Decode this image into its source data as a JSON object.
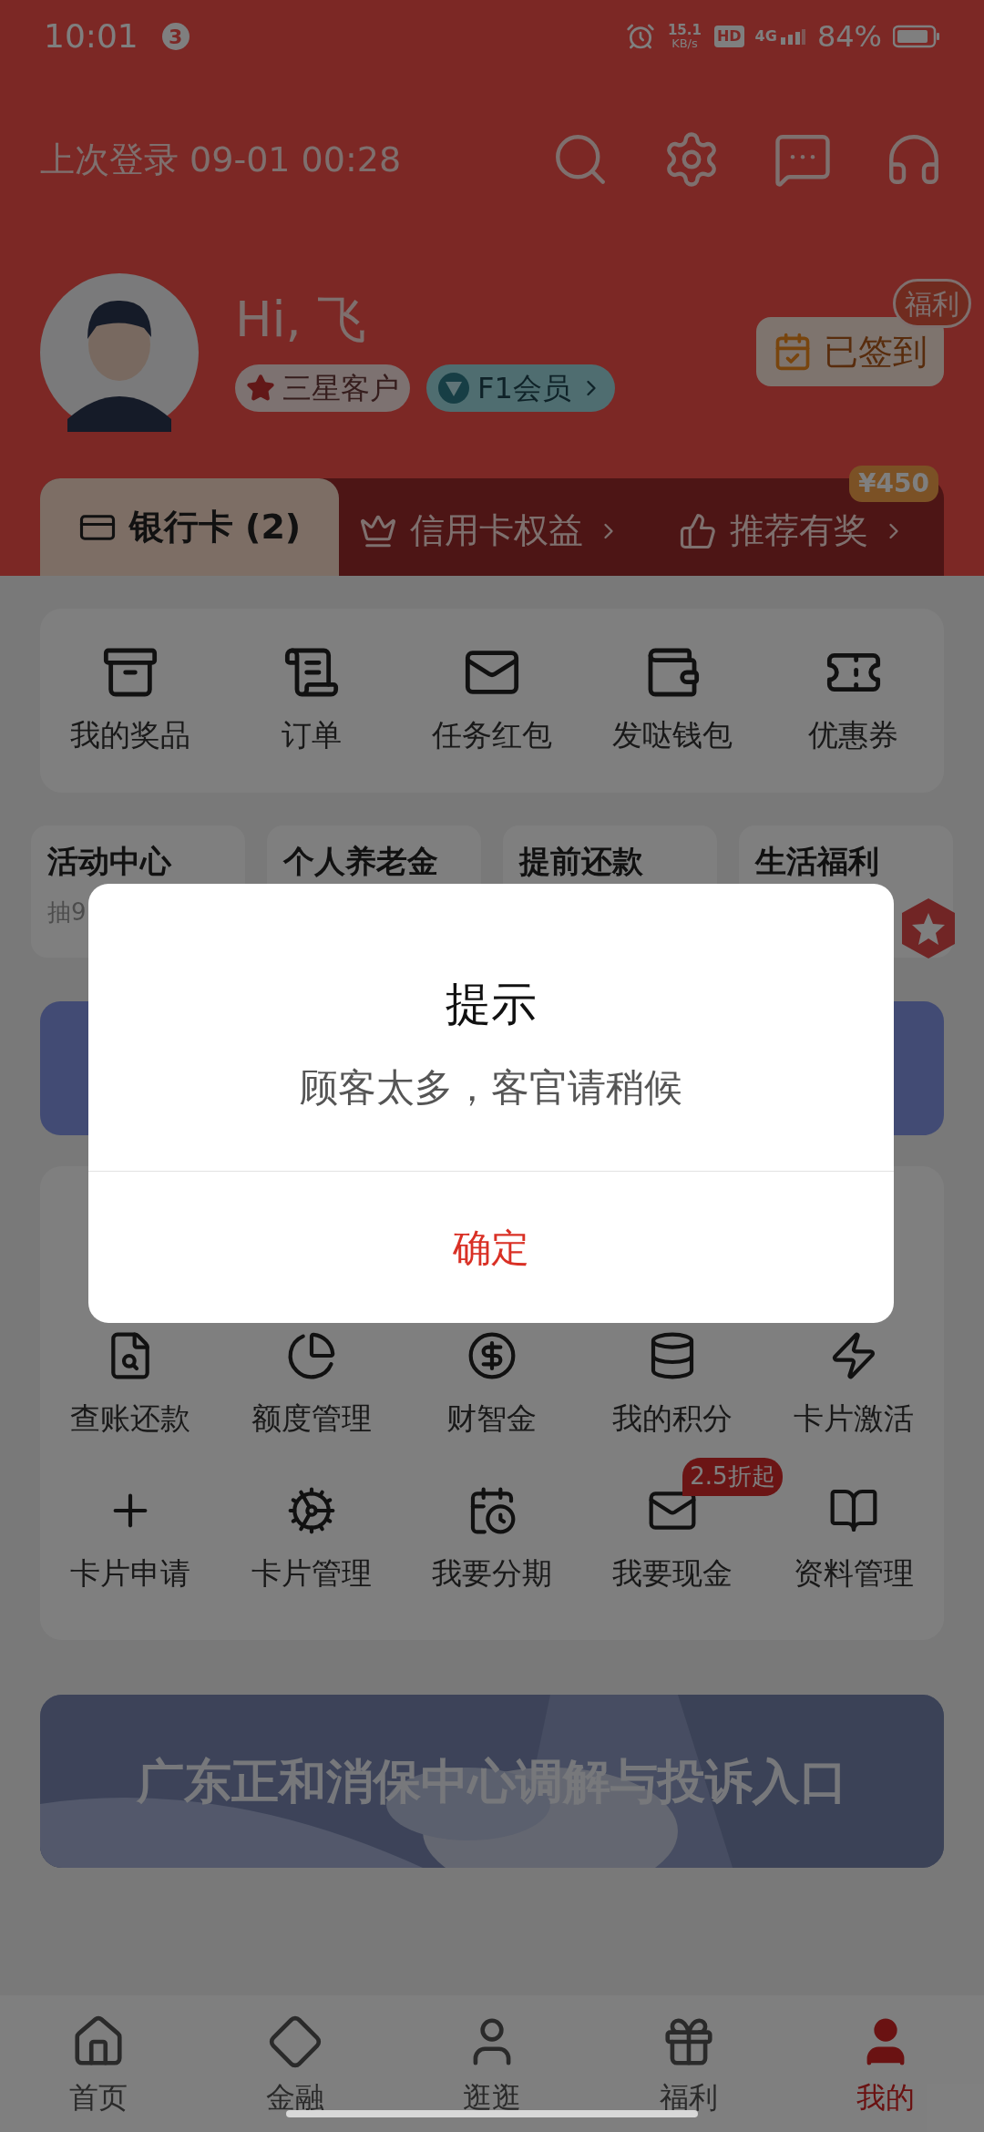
{
  "status_bar": {
    "time": "10:01",
    "notification_count": "3",
    "net_speed": "15.1",
    "net_unit": "KB/s",
    "hd": "HD",
    "network": "4G",
    "battery": "84%"
  },
  "header": {
    "last_login": "上次登录 09-01 00:28",
    "greeting": "Hi, 飞",
    "badges": [
      {
        "label": "三星客户",
        "kind": "star"
      },
      {
        "label": "F1会员",
        "kind": "member"
      }
    ],
    "checkin": {
      "label": "已签到",
      "tag": "福利"
    }
  },
  "tabs": [
    {
      "label": "银行卡 (2)",
      "selected": true,
      "kind": "card"
    },
    {
      "label": "信用卡权益",
      "selected": false,
      "kind": "crown"
    },
    {
      "label": "推荐有奖",
      "selected": false,
      "kind": "thumb",
      "badge": "¥450"
    }
  ],
  "shortcuts": [
    {
      "label": "我的奖品",
      "kind": "box"
    },
    {
      "label": "订单",
      "kind": "scroll"
    },
    {
      "label": "任务红包",
      "kind": "envelope"
    },
    {
      "label": "发哒钱包",
      "kind": "wallet"
    },
    {
      "label": "优惠券",
      "kind": "ticket"
    }
  ],
  "activities": [
    {
      "title": "活动中心",
      "subtitle": "抽9"
    },
    {
      "title": "个人养老金"
    },
    {
      "title": "提前还款"
    },
    {
      "title": "生活福利"
    }
  ],
  "credit_services": [
    {
      "label": "查账还款",
      "kind": "bill"
    },
    {
      "label": "额度管理",
      "kind": "pie"
    },
    {
      "label": "财智金",
      "kind": "yen"
    },
    {
      "label": "我的积分",
      "kind": "coins"
    },
    {
      "label": "卡片激活",
      "kind": "activate"
    },
    {
      "label": "卡片申请",
      "kind": "apply"
    },
    {
      "label": "卡片管理",
      "kind": "manage"
    },
    {
      "label": "我要分期",
      "kind": "calendar"
    },
    {
      "label": "我要现金",
      "kind": "cash",
      "badge": "2.5折起"
    },
    {
      "label": "资料管理",
      "kind": "book"
    }
  ],
  "banner": {
    "text": "广东正和消保中心调解与投诉入口"
  },
  "bottom_nav": [
    {
      "label": "首页",
      "selected": false,
      "kind": "home"
    },
    {
      "label": "金融",
      "selected": false,
      "kind": "finance"
    },
    {
      "label": "逛逛",
      "selected": false,
      "kind": "browse"
    },
    {
      "label": "福利",
      "selected": false,
      "kind": "gift"
    },
    {
      "label": "我的",
      "selected": true,
      "kind": "me"
    }
  ],
  "dialog": {
    "title": "提示",
    "message": "顾客太多，客官请稍候",
    "confirm": "确定"
  }
}
